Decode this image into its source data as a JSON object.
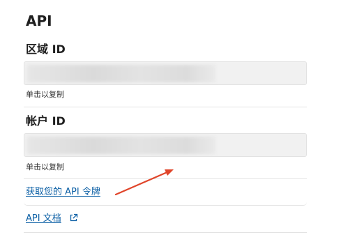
{
  "section": {
    "title": "API"
  },
  "region": {
    "label": "区域 ID",
    "value": "",
    "hint": "单击以复制"
  },
  "account": {
    "label": "帐户 ID",
    "value": "",
    "hint": "单击以复制"
  },
  "links": {
    "get_token": "获取您的 API 令牌",
    "api_docs": "API 文档"
  },
  "icons": {
    "external_link": "external-link-icon",
    "annotation": "red-arrow-annotation"
  },
  "colors": {
    "link": "#0b5fa5",
    "field_background": "#f1f1f1",
    "annotation_arrow": "#e0452a"
  }
}
